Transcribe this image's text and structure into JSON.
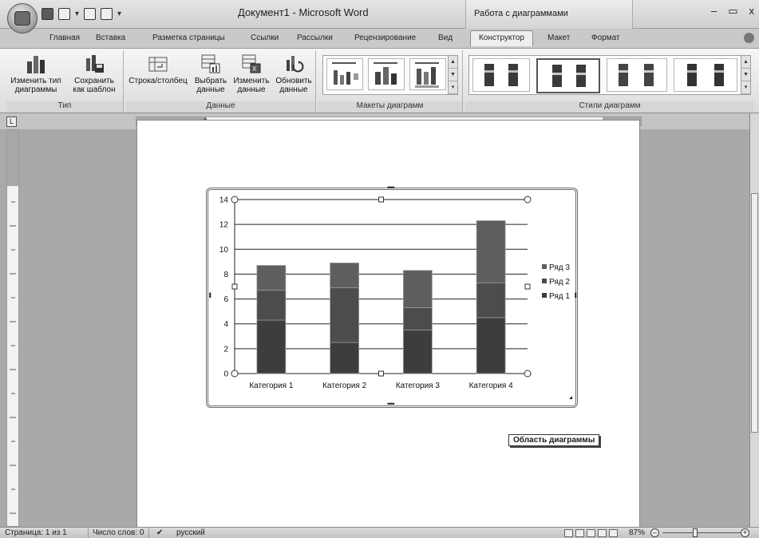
{
  "title_bar": {
    "document_title": "Документ1 - Microsoft Word",
    "contextual_group": "Работа с диаграммами"
  },
  "tabs": [
    "Главная",
    "Вставка",
    "Разметка страницы",
    "Ссылки",
    "Рассылки",
    "Рецензирование",
    "Вид",
    "Конструктор",
    "Макет",
    "Формат"
  ],
  "ribbon": {
    "type_group": {
      "label": "Тип",
      "change_type": [
        "Изменить тип",
        "диаграммы"
      ],
      "save_template": [
        "Сохранить",
        "как шаблон"
      ]
    },
    "data_group": {
      "label": "Данные",
      "row_column": [
        "Строка/столбец",
        ""
      ],
      "select_data": [
        "Выбрать",
        "данные"
      ],
      "edit_data": [
        "Изменить",
        "данные"
      ],
      "refresh_data": [
        "Обновить",
        "данные"
      ]
    },
    "layouts_group": {
      "label": "Макеты диаграмм"
    },
    "styles_group": {
      "label": "Стили диаграмм"
    }
  },
  "chart_data": {
    "type": "bar",
    "stacked": true,
    "categories": [
      "Категория 1",
      "Категория 2",
      "Категория 3",
      "Категория 4"
    ],
    "series": [
      {
        "name": "Ряд 1",
        "values": [
          4.3,
          2.5,
          3.5,
          4.5
        ]
      },
      {
        "name": "Ряд 2",
        "values": [
          2.4,
          4.4,
          1.8,
          2.8
        ]
      },
      {
        "name": "Ряд 3",
        "values": [
          2.0,
          2.0,
          3.0,
          5.0
        ]
      }
    ],
    "ylim": [
      0,
      14
    ],
    "yticks": [
      "0",
      "2",
      "4",
      "6",
      "8",
      "10",
      "12",
      "14"
    ],
    "grid": true,
    "legend_position": "right",
    "colors": [
      "#3d3d3d",
      "#4c4c4c",
      "#5e5e5e"
    ]
  },
  "tooltip": "Область диаграммы",
  "status_bar": {
    "page": "Страница: 1 из 1",
    "words": "Число слов: 0",
    "language": "русский",
    "zoom": "87%"
  }
}
